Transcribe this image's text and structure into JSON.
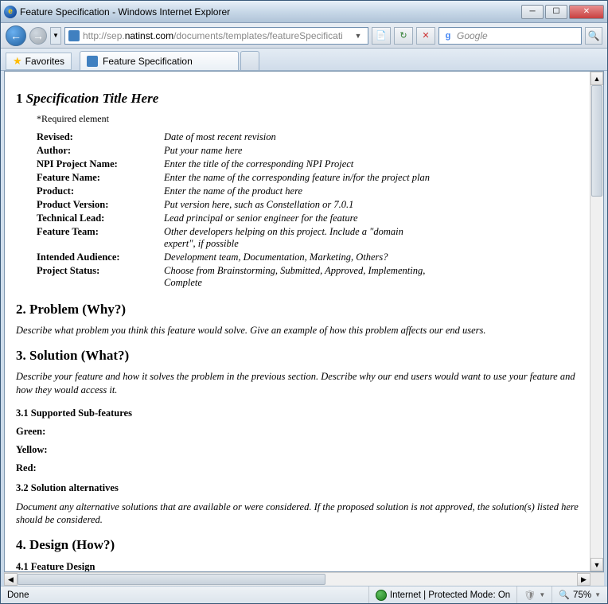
{
  "window": {
    "title": "Feature Specification - Windows Internet Explorer"
  },
  "nav": {
    "url_prefix": "http://sep.",
    "url_host": "natinst.com",
    "url_path": "/documents/templates/featureSpecificati",
    "search_provider": "Google"
  },
  "favbar": {
    "favorites": "Favorites",
    "tab_title": "Feature Specification"
  },
  "doc": {
    "h1_num": "1",
    "h1_title": "Specification Title Here",
    "required_note": "*Required element",
    "meta": [
      {
        "label": "Revised:",
        "value": "Date of most recent revision"
      },
      {
        "label": "Author:",
        "value": "Put your name here"
      },
      {
        "label": "NPI Project Name:",
        "value": "Enter the title of the corresponding NPI Project"
      },
      {
        "label": "Feature Name:",
        "value": "Enter the name of the corresponding feature in/for the project plan"
      },
      {
        "label": "Product:",
        "value": "Enter the name of the product here"
      },
      {
        "label": "Product Version:",
        "value": "Put version here, such as Constellation or 7.0.1"
      },
      {
        "label": "Technical Lead:",
        "value": "Lead principal or senior engineer for the feature"
      },
      {
        "label": "Feature Team:",
        "value": "Other developers helping on this project. Include a \"domain expert\", if possible"
      },
      {
        "label": "Intended Audience:",
        "value": "Development team, Documentation, Marketing, Others?"
      },
      {
        "label": "Project Status:",
        "value": "Choose from Brainstorming, Submitted, Approved, Implementing, Complete"
      }
    ],
    "h2": "2. Problem (Why?)",
    "h2_desc": "Describe what problem you think this feature would solve. Give an example of how this problem affects our end users.",
    "h3": "3. Solution (What?)",
    "h3_desc": "Describe your feature and how it solves the problem in the previous section. Describe why our end users would want to use your feature and how they would access it.",
    "h3_1": "3.1 Supported Sub-features",
    "green": "Green",
    "yellow": "Yellow",
    "red": "Red",
    "h3_2": "3.2 Solution alternatives",
    "h3_2_desc": "Document any alternative solutions that are available or were considered. If the proposed solution is not approved, the solution(s) listed here should be considered.",
    "h4": "4. Design (How?)",
    "h4_1": "4.1 Feature Design"
  },
  "status": {
    "left": "Done",
    "zone": "Internet | Protected Mode: On",
    "zoom": "75%"
  }
}
